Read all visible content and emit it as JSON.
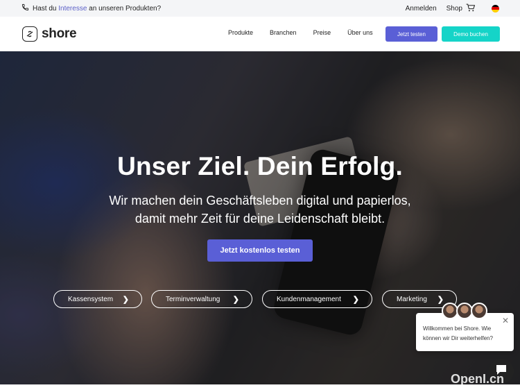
{
  "topbar": {
    "interest_prefix": "Hast du",
    "interest_link": "Interesse",
    "interest_suffix": "an unseren Produkten?",
    "login": "Anmelden",
    "shop": "Shop"
  },
  "nav": {
    "logo": "shore",
    "links": [
      "Produkte",
      "Branchen",
      "Preise",
      "Über uns"
    ],
    "trial_button": "Jetzt testen",
    "demo_button": "Demo buchen"
  },
  "hero": {
    "title": "Unser Ziel. Dein Erfolg.",
    "subtitle_line1": "Wir machen dein Geschäftsleben digital und papierlos,",
    "subtitle_line2": "damit mehr Zeit für deine Leidenschaft bleibt.",
    "cta": "Jetzt kostenlos testen",
    "categories": [
      "Kassensystem",
      "Terminverwaltung",
      "Kundenmanagement",
      "Marketing"
    ],
    "chevron": "❯"
  },
  "chat": {
    "message_line1": "Willkommen bei Shore. Wie",
    "message_line2": "können wir Dir weiterhelfen?",
    "close": "✕"
  },
  "watermark": "OpenI.cn",
  "colors": {
    "accent": "#5a5fd6",
    "demo": "#15d4c8",
    "link": "#5b5fc7"
  }
}
